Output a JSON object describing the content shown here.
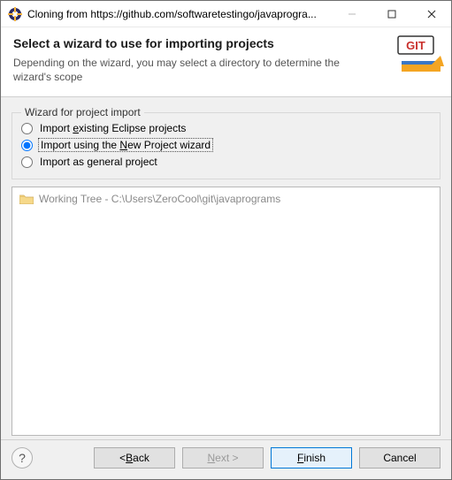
{
  "titlebar": {
    "title": "Cloning from https://github.com/softwaretestingo/javaprogra..."
  },
  "header": {
    "heading": "Select a wizard to use for importing projects",
    "subtext": "Depending on the wizard, you may select a directory to determine the wizard's scope",
    "banner_label": "GIT"
  },
  "group": {
    "legend": "Wizard for project import",
    "options": {
      "existing_pre": "Import ",
      "existing_u": "e",
      "existing_post": "xisting Eclipse projects",
      "newproj_pre": "Import using the ",
      "newproj_u": "N",
      "newproj_post": "ew Project wizard",
      "general": "Import as general project"
    }
  },
  "tree": {
    "row0": "Working Tree - C:\\Users\\ZeroCool\\git\\javaprograms"
  },
  "footer": {
    "back_pre": "< ",
    "back_u": "B",
    "back_post": "ack",
    "next_u": "N",
    "next_post": "ext >",
    "finish_u": "F",
    "finish_post": "inish",
    "cancel": "Cancel"
  }
}
